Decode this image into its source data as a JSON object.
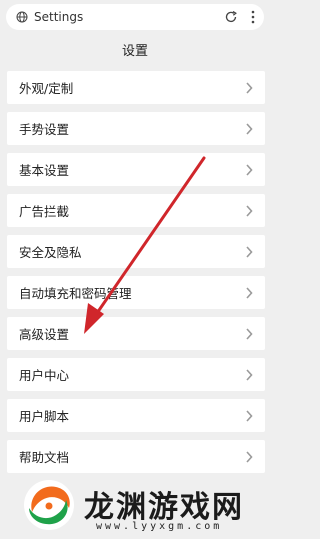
{
  "address_bar": {
    "url": "Settings"
  },
  "page_title": "设置",
  "settings_items": [
    {
      "label": "外观/定制"
    },
    {
      "label": "手势设置"
    },
    {
      "label": "基本设置"
    },
    {
      "label": "广告拦截"
    },
    {
      "label": "安全及隐私"
    },
    {
      "label": "自动填充和密码管理"
    },
    {
      "label": "高级设置"
    },
    {
      "label": "用户中心"
    },
    {
      "label": "用户脚本"
    },
    {
      "label": "帮助文档"
    }
  ],
  "watermark": {
    "brand": "龙渊游戏网",
    "site": "www.lyyxgm.com"
  },
  "colors": {
    "arrow": "#d0262b",
    "logo_orange": "#f26b1d",
    "logo_green": "#1fa24a"
  }
}
